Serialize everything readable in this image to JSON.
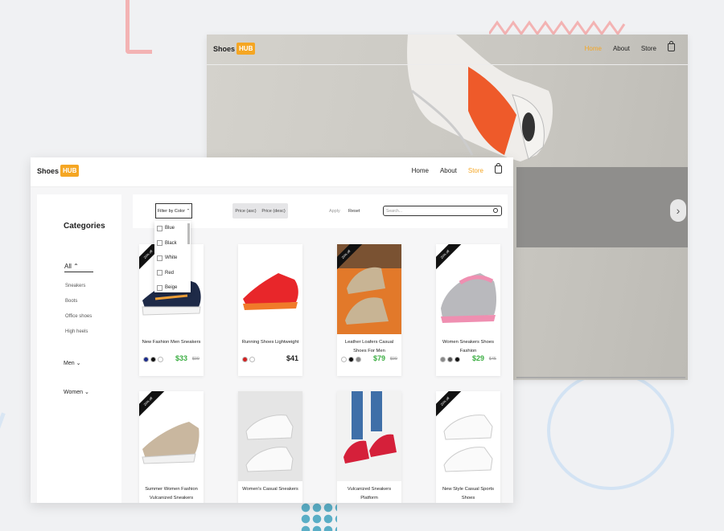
{
  "back_site": {
    "logo": {
      "text": "Shoes",
      "badge": "HUB"
    },
    "nav": [
      "Home",
      "About",
      "Store"
    ],
    "active_nav": "Home",
    "next_icon": "chevron-right-icon"
  },
  "front_site": {
    "logo": {
      "text": "Shoes",
      "badge": "HUB"
    },
    "nav": [
      "Home",
      "About",
      "Store"
    ],
    "active_nav": "Store"
  },
  "sidebar": {
    "title": "Categories",
    "all": "All",
    "subcategories": [
      "Sneakers",
      "Boots",
      "Office shoes",
      "High heels"
    ],
    "groups": [
      "Men",
      "Women"
    ]
  },
  "toolbar": {
    "filter_label": "Filter by Color",
    "color_options": [
      "Blue",
      "Black",
      "White",
      "Red",
      "Beige"
    ],
    "price_asc": "Price (asc)",
    "price_desc": "Price (desc)",
    "apply": "Apply",
    "reset": "Reset",
    "search_placeholder": "Search..."
  },
  "products": [
    {
      "name": "New Fashion Men Sneakers",
      "price": "$33",
      "old_price": "$99",
      "discount": "20% off",
      "swatches": [
        "#1c2c8c",
        "#111111",
        "#ffffff"
      ]
    },
    {
      "name": "Running Shoes Lightweight",
      "price": "$41",
      "old_price": "",
      "discount": "",
      "swatches": [
        "#d32020",
        "#ffffff"
      ]
    },
    {
      "name": "Leather Loafers Casual Shoes For Men",
      "price": "$79",
      "old_price": "$99",
      "discount": "20% off",
      "swatches": [
        "#ffffff",
        "#111111",
        "#888888"
      ]
    },
    {
      "name": "Women Sneakers Shoes Fashion",
      "price": "$29",
      "old_price": "$45",
      "discount": "20% off",
      "swatches": [
        "#888888",
        "#555555",
        "#111111"
      ]
    },
    {
      "name": "Summer Women Fashion Vulcanized Sneakers",
      "price": "",
      "old_price": "",
      "discount": "20% off",
      "swatches": []
    },
    {
      "name": "Women's Casual Sneakers",
      "price": "",
      "old_price": "",
      "discount": "",
      "swatches": []
    },
    {
      "name": "Vulcanized Sneakers Platform",
      "price": "",
      "old_price": "",
      "discount": "",
      "swatches": []
    },
    {
      "name": "New Style Casual Sports Shoes",
      "price": "",
      "old_price": "",
      "discount": "20% off",
      "swatches": []
    }
  ]
}
